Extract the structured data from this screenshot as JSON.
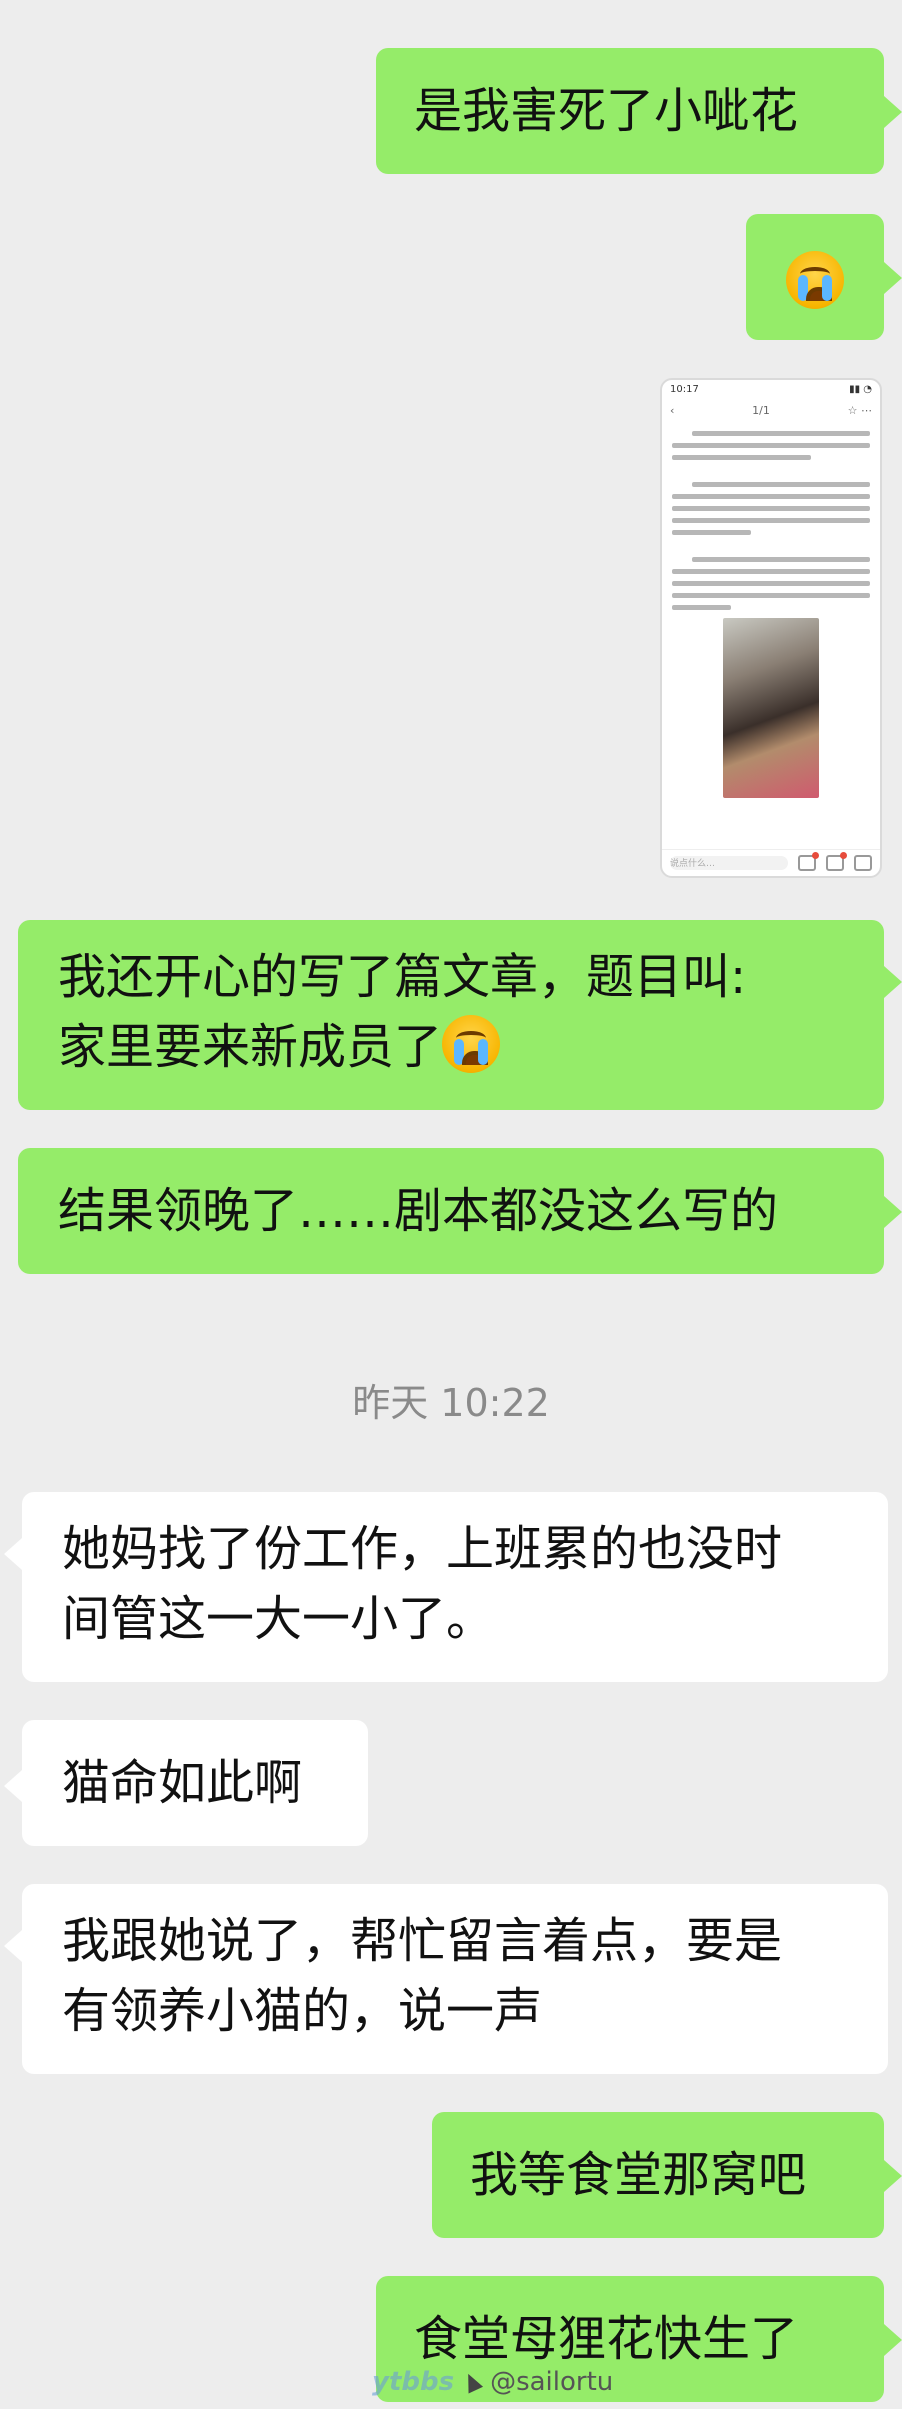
{
  "messages": [
    {
      "side": "me",
      "text": "是我害死了小呲花"
    },
    {
      "side": "me",
      "emoji": "crying-emoji"
    },
    {
      "side": "me",
      "type": "image",
      "image": {
        "status_time": "10:17",
        "page": "1/1",
        "footer_placeholder": "说点什么…"
      }
    },
    {
      "side": "me",
      "text": "我还开心的写了篇文章，题目叫:",
      "text2": "家里要来新成员了"
    },
    {
      "side": "me",
      "text": "结果领晚了……剧本都没这么写的"
    },
    {
      "side": "them",
      "text": "她妈找了份工作，上班累的也没时",
      "text2": "间管这一大一小了。"
    },
    {
      "side": "them",
      "text": "猫命如此啊"
    },
    {
      "side": "them",
      "text": "我跟她说了，帮忙留言着点，要是",
      "text2": "有领养小猫的，说一声"
    },
    {
      "side": "me",
      "text": "我等食堂那窝吧"
    },
    {
      "side": "me",
      "text": "食堂母狸花快生了"
    }
  ],
  "timestamp": "昨天 10:22",
  "watermark": {
    "logo": "ytbbs",
    "user": "@sailortu"
  },
  "colors": {
    "me_bubble": "#95ec69",
    "them_bubble": "#ffffff",
    "background": "#ededed"
  }
}
